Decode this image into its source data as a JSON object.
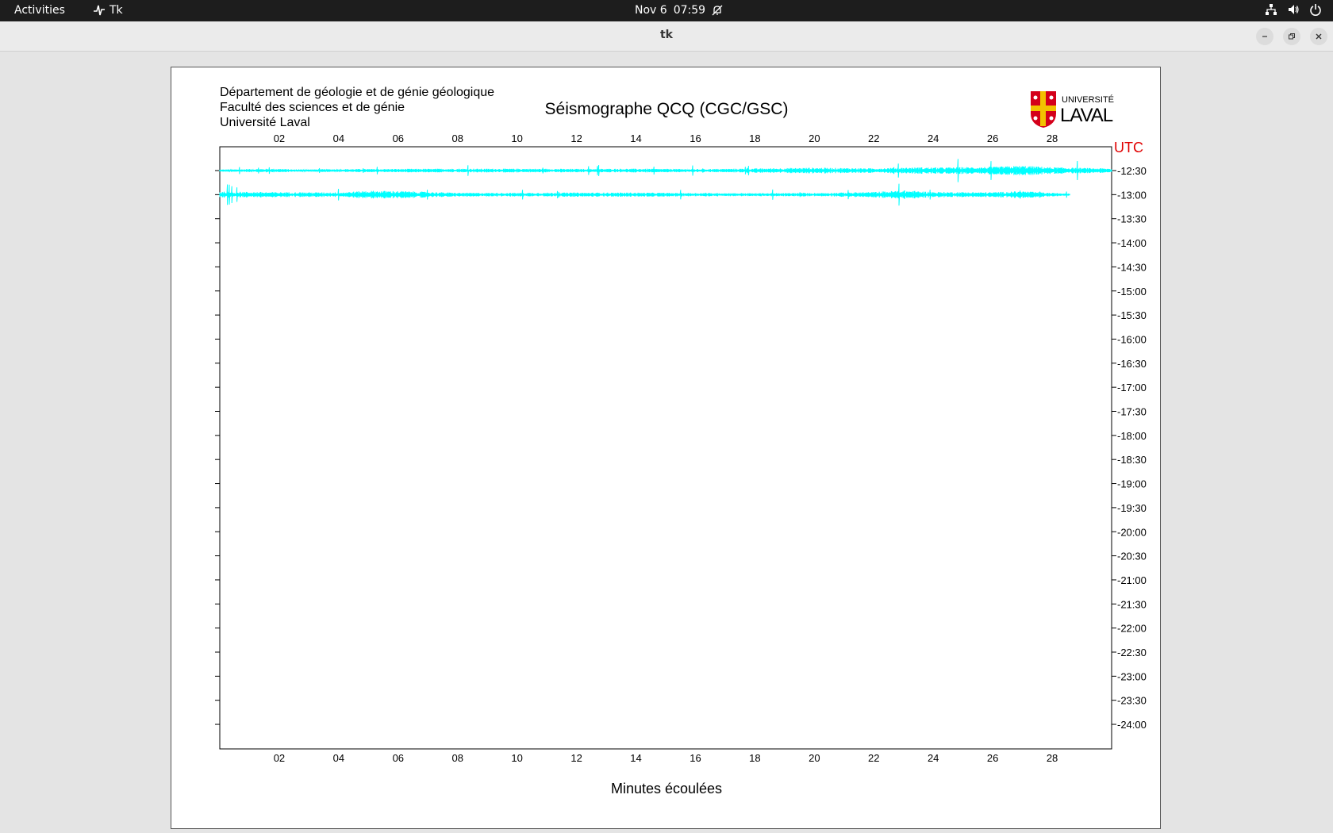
{
  "topbar": {
    "activities": "Activities",
    "app_name": "Tk",
    "date": "Nov 6",
    "time": "07:59",
    "icons": [
      "network-icon",
      "volume-icon",
      "power-icon",
      "bell-muted-icon"
    ]
  },
  "window": {
    "title": "tk"
  },
  "seismogram": {
    "header_lines": [
      "Département de géologie et de génie géologique",
      "Faculté des sciences et de génie",
      "Université Laval"
    ],
    "title": "Séismographe QCQ (CGC/GSC)",
    "logo_text_top": "UNIVERSITÉ",
    "logo_text_bottom": "LAVAL",
    "utc_label": "UTC",
    "x_label": "Minutes écoulées",
    "trace_color": "#00ffff",
    "utc_color": "#e00000"
  },
  "chart_data": {
    "type": "line",
    "title": "Séismographe QCQ (CGC/GSC)",
    "xlabel": "Minutes écoulées",
    "ylabel": "UTC",
    "x_ticks": [
      "02",
      "04",
      "06",
      "08",
      "10",
      "12",
      "14",
      "16",
      "18",
      "20",
      "22",
      "24",
      "26",
      "28"
    ],
    "xlim": [
      0,
      30
    ],
    "y_ticks": [
      "12:30",
      "13:00",
      "13:30",
      "14:00",
      "14:30",
      "15:00",
      "15:30",
      "16:00",
      "16:30",
      "17:00",
      "17:30",
      "18:00",
      "18:30",
      "19:00",
      "19:30",
      "20:00",
      "20:30",
      "21:00",
      "21:30",
      "22:00",
      "22:30",
      "23:00",
      "23:30",
      "24:00"
    ],
    "series": [
      {
        "row": "12:30",
        "x_end": 30,
        "x": [
          0,
          2,
          2.5,
          4,
          6,
          8,
          10,
          12,
          14,
          16,
          18,
          20,
          22,
          23.5,
          24,
          26,
          27,
          28,
          29,
          30
        ],
        "amplitude": [
          1,
          1.8,
          1,
          1.4,
          1.6,
          1.8,
          1.8,
          1.6,
          1.8,
          1.4,
          2,
          2.8,
          2.2,
          3.2,
          3,
          3.6,
          4.8,
          3.2,
          2.6,
          2
        ]
      },
      {
        "row": "13:00",
        "x_end": 28.6,
        "x": [
          0,
          2,
          4,
          5,
          6,
          8,
          10,
          12,
          14,
          16,
          18,
          20,
          22,
          23,
          24,
          26,
          27,
          28,
          28.6
        ],
        "amplitude": [
          3,
          2.4,
          2.2,
          3.8,
          3.6,
          1.8,
          1.8,
          2,
          2,
          1.6,
          1.4,
          1.6,
          2.6,
          4.2,
          2.6,
          2.4,
          3.4,
          1.6,
          1.4
        ]
      }
    ],
    "grid": false
  }
}
